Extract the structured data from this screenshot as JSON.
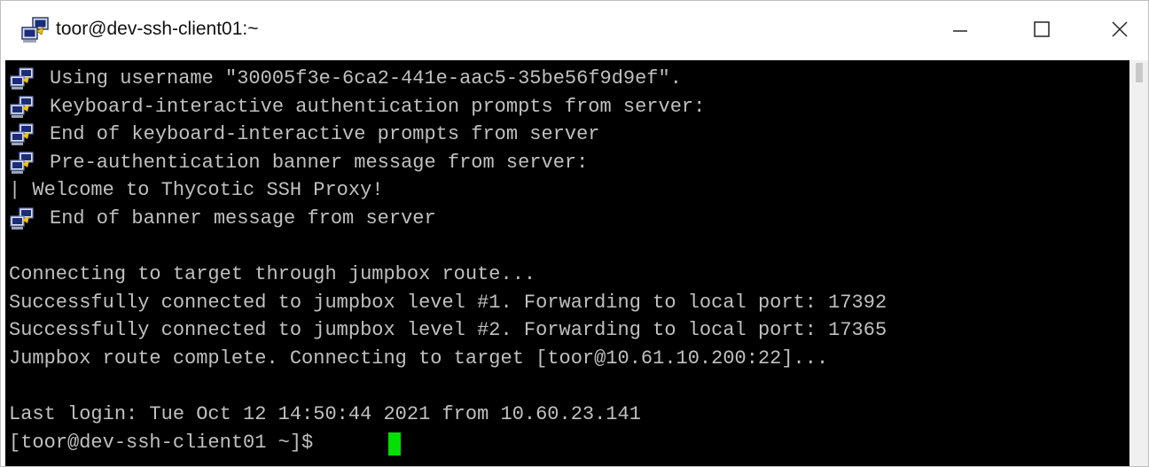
{
  "window": {
    "title": "toor@dev-ssh-client01:~",
    "icon": "putty-icon",
    "controls": {
      "minimize": "—",
      "maximize": "☐",
      "close": "✕"
    }
  },
  "terminal": {
    "background": "#000000",
    "foreground": "#c0c0c0",
    "cursor_color": "#00e000",
    "lines": [
      {
        "text": "Using username \"30005f3e-6ca2-441e-aac5-35be56f9d9ef\".",
        "icon": true
      },
      {
        "text": "Keyboard-interactive authentication prompts from server:",
        "icon": true
      },
      {
        "text": "End of keyboard-interactive prompts from server",
        "icon": true
      },
      {
        "text": "Pre-authentication banner message from server:",
        "icon": true
      },
      {
        "text": "| Welcome to Thycotic SSH Proxy!",
        "icon": false
      },
      {
        "text": "End of banner message from server",
        "icon": true
      },
      {
        "text": "",
        "icon": false
      },
      {
        "text": "Connecting to target through jumpbox route...",
        "icon": false
      },
      {
        "text": "Successfully connected to jumpbox level #1. Forwarding to local port: 17392",
        "icon": false
      },
      {
        "text": "Successfully connected to jumpbox level #2. Forwarding to local port: 17365",
        "icon": false
      },
      {
        "text": "Jumpbox route complete. Connecting to target [toor@10.61.10.200:22]...",
        "icon": false
      },
      {
        "text": "",
        "icon": false
      },
      {
        "text": "Last login: Tue Oct 12 14:50:44 2021 from 10.60.23.141",
        "icon": false
      },
      {
        "text": "[toor@dev-ssh-client01 ~]$ ",
        "icon": false
      }
    ]
  }
}
